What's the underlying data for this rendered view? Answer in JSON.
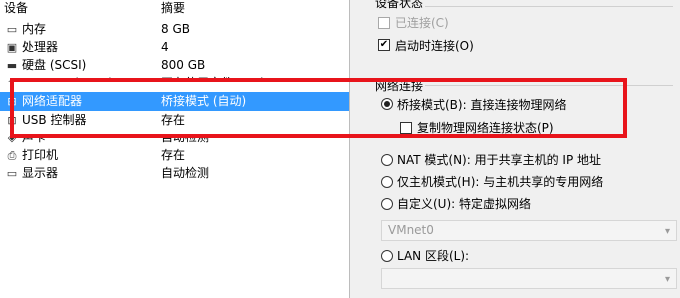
{
  "devices_header": {
    "device": "设备",
    "summary": "摘要"
  },
  "devices": [
    {
      "icon": "memory-icon",
      "glyph": "▭",
      "name": "内存",
      "summary": "8 GB"
    },
    {
      "icon": "cpu-icon",
      "glyph": "▣",
      "name": "处理器",
      "summary": "4"
    },
    {
      "icon": "disk-icon",
      "glyph": "▬",
      "name": "硬盘 (SCSI)",
      "summary": "800 GB"
    },
    {
      "icon": "cd-dvd-icon",
      "glyph": "◉",
      "name": "CD/DVD (SATA)",
      "summary": "正在使用文件 E:\\ubuntu-16.04..."
    },
    {
      "icon": "network-adapter-icon",
      "glyph": "⊞",
      "name": "网络适配器",
      "summary": "桥接模式 (自动)"
    },
    {
      "icon": "usb-icon",
      "glyph": "⊡",
      "name": "USB 控制器",
      "summary": "存在"
    },
    {
      "icon": "sound-card-icon",
      "glyph": "◈",
      "name": "声卡",
      "summary": "自动检测"
    },
    {
      "icon": "printer-icon",
      "glyph": "⎙",
      "name": "打印机",
      "summary": "存在"
    },
    {
      "icon": "display-icon",
      "glyph": "▭",
      "name": "显示器",
      "summary": "自动检测"
    }
  ],
  "device_status": {
    "title": "设备状态",
    "connected": "已连接(C)",
    "connect_on_start": "启动时连接(O)"
  },
  "network": {
    "title": "网络连接",
    "bridged": "桥接模式(B): 直接连接物理网络",
    "replicate": "复制物理网络连接状态(P)",
    "nat": "NAT 模式(N): 用于共享主机的 IP 地址",
    "host_only": "仅主机模式(H): 与主机共享的专用网络",
    "custom": "自定义(U): 特定虚拟网络",
    "vmnet_value": "VMnet0",
    "lan": "LAN 区段(L):",
    "lan_value": ""
  },
  "colors": {
    "selection": "#3399ff",
    "highlight_box": "#e8141b"
  }
}
